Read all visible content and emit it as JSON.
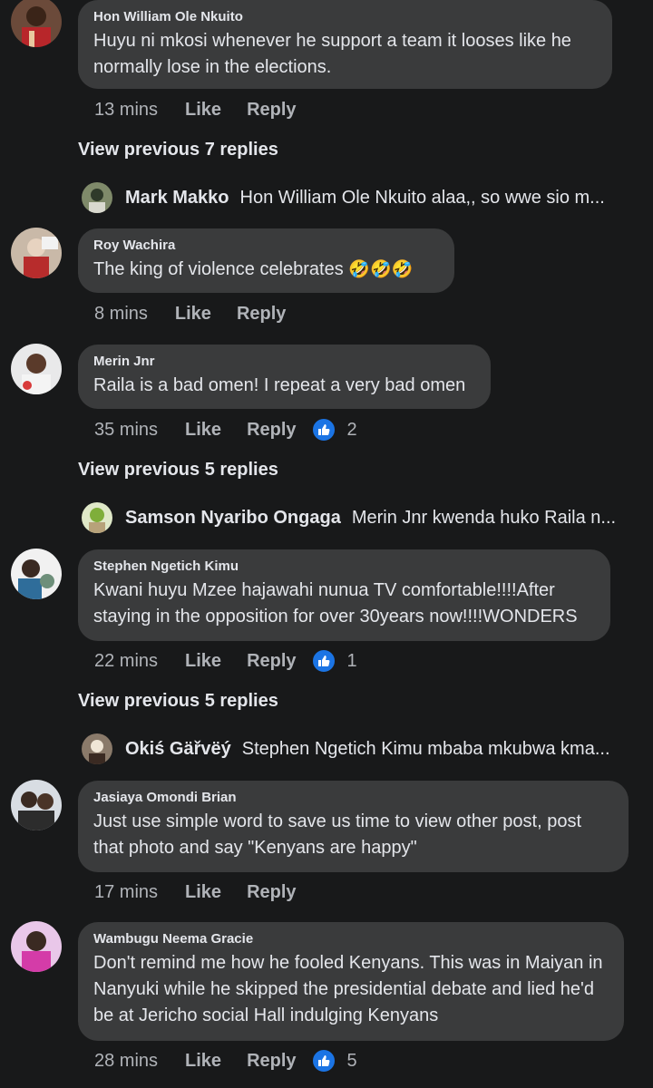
{
  "comments": [
    {
      "name": "Hon William Ole Nkuito",
      "text": "Huyu ni mkosi whenever he support a team it looses like he normally lose in the elections.",
      "time": "13 mins",
      "like": "Like",
      "reply": "Reply"
    },
    {
      "name": "Roy Wachira",
      "text": "The king of violence celebrates",
      "emoji": "🤣🤣🤣",
      "time": "8 mins",
      "like": "Like",
      "reply": "Reply"
    },
    {
      "name": "Merin Jnr",
      "text": "Raila is a bad omen! I repeat a very bad omen",
      "time": "35 mins",
      "like": "Like",
      "reply": "Reply",
      "likes": "2"
    },
    {
      "name": "Stephen Ngetich Kimu",
      "text": "Kwani huyu Mzee hajawahi nunua TV comfortable!!!!After staying in the opposition for over 30years now!!!!WONDERS",
      "time": "22 mins",
      "like": "Like",
      "reply": "Reply",
      "likes": "1"
    },
    {
      "name": "Jasiaya Omondi Brian",
      "text": "Just use simple word to save us time to view other post, post that photo and say \"Kenyans are happy\"",
      "time": "17 mins",
      "like": "Like",
      "reply": "Reply"
    },
    {
      "name": "Wambugu Neema Gracie",
      "text": "Don't remind me how he fooled Kenyans. This was in Maiyan in Nanyuki while he skipped the presidential debate and lied he'd be at Jericho social Hall indulging Kenyans",
      "time": "28 mins",
      "like": "Like",
      "reply": "Reply",
      "likes": "5"
    }
  ],
  "view_previous": [
    "View previous 7 replies",
    "View previous 5 replies",
    "View previous 5 replies"
  ],
  "latest_replies": [
    {
      "name": "Mark Makko",
      "text": "Hon William Ole Nkuito  alaa,, so wwe sio m..."
    },
    {
      "name": "Samson Nyaribo Ongaga",
      "text": "Merin Jnr kwenda huko Raila n..."
    },
    {
      "name": "Okiś Gäřvëý",
      "text": "Stephen Ngetich Kimu mbaba mkubwa kma..."
    }
  ],
  "colors": {
    "background": "#18191a",
    "bubble": "#3a3b3c",
    "meta": "#b0b3b8",
    "like_badge": "#1b74e4"
  },
  "icons": [
    "thumbs-up-icon",
    "laughing-emoji-icon"
  ]
}
